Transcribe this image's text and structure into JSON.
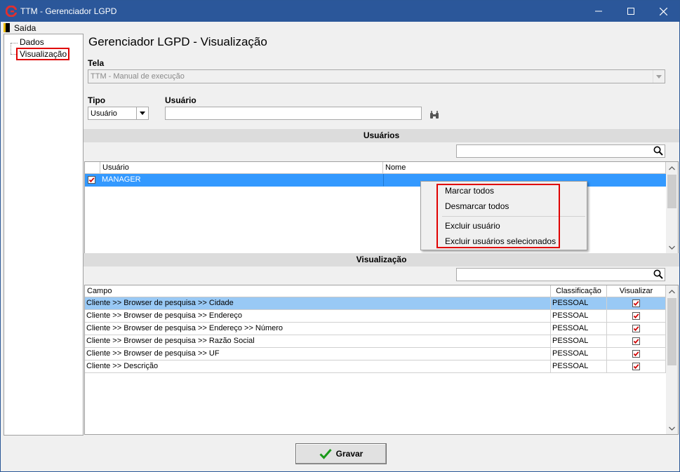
{
  "window": {
    "title": "TTM - Gerenciador LGPD"
  },
  "menu": {
    "exit_label": "Saída"
  },
  "tree": {
    "items": [
      {
        "label": "Dados"
      },
      {
        "label": "Visualização"
      }
    ]
  },
  "page": {
    "title": "Gerenciador LGPD - Visualização"
  },
  "form": {
    "tela_label": "Tela",
    "tela_value": "TTM - Manual de execução",
    "tipo_label": "Tipo",
    "tipo_value": "Usuário",
    "usuario_label": "Usuário",
    "usuario_value": ""
  },
  "users_section": {
    "title": "Usuários",
    "search_value": "",
    "columns": [
      "Usuário",
      "Nome"
    ],
    "rows": [
      {
        "checked": true,
        "usuario": "MANAGER",
        "nome": ""
      }
    ]
  },
  "context_menu": {
    "items": [
      "Marcar todos",
      "Desmarcar todos",
      "Excluir usuário",
      "Excluir usuários selecionados"
    ]
  },
  "view_section": {
    "title": "Visualização",
    "search_value": "",
    "columns": [
      "Campo",
      "Classificação",
      "Visualizar"
    ],
    "rows": [
      {
        "campo": "Cliente >> Browser de pesquisa >> Cidade",
        "classificacao": "PESSOAL",
        "visualizar": true
      },
      {
        "campo": "Cliente >> Browser de pesquisa >> Endereço",
        "classificacao": "PESSOAL",
        "visualizar": true
      },
      {
        "campo": "Cliente >> Browser de pesquisa >> Endereço >> Número",
        "classificacao": "PESSOAL",
        "visualizar": true
      },
      {
        "campo": "Cliente >> Browser de pesquisa >> Razão Social",
        "classificacao": "PESSOAL",
        "visualizar": true
      },
      {
        "campo": "Cliente >> Browser de pesquisa >> UF",
        "classificacao": "PESSOAL",
        "visualizar": true
      },
      {
        "campo": "Cliente >> Descrição",
        "classificacao": "PESSOAL",
        "visualizar": true
      }
    ]
  },
  "footer": {
    "save_label": "Gravar"
  },
  "colors": {
    "titlebar": "#2b579a",
    "selection": "#3399ff",
    "highlight_border": "#e00000",
    "checkmark": "#d00000"
  }
}
